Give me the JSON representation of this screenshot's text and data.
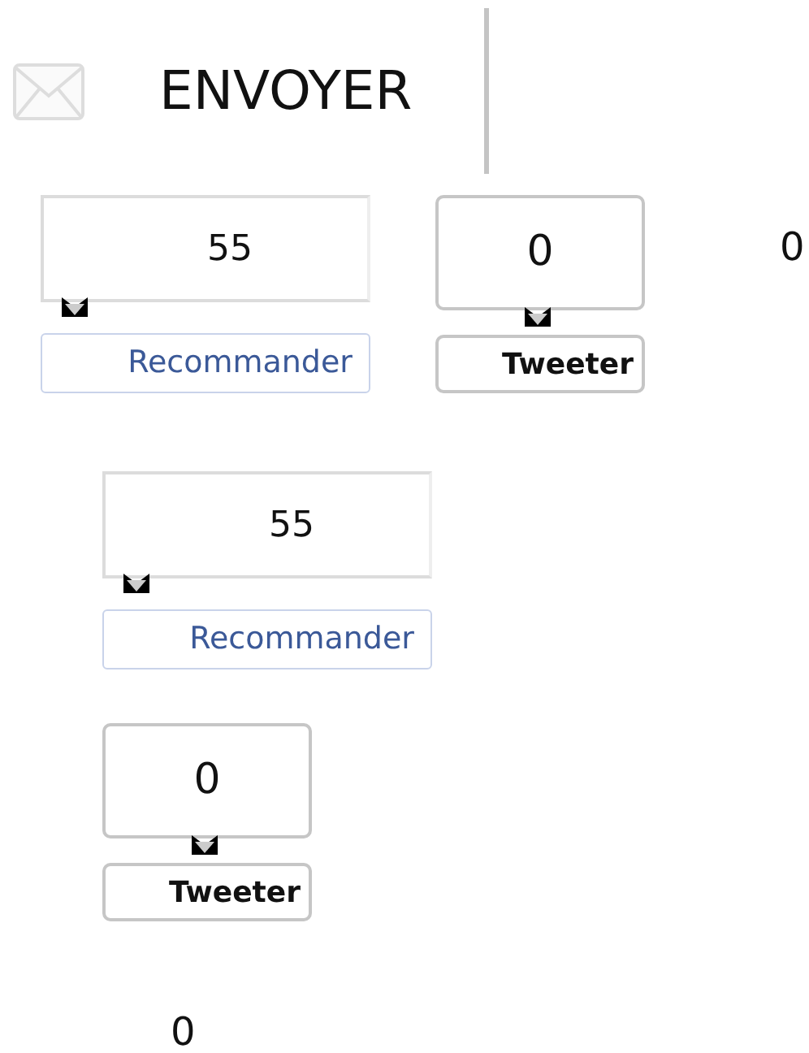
{
  "email": {
    "label": "ENVOYER"
  },
  "share_rows": [
    [
      {
        "kind": "facebook",
        "count": "55",
        "label": "Recommander"
      },
      {
        "kind": "twitter",
        "count": "0",
        "label": "Tweeter"
      },
      {
        "kind": "plain",
        "count": "0"
      }
    ],
    [
      {
        "kind": "facebook",
        "count": "55",
        "label": "Recommander"
      }
    ],
    [
      {
        "kind": "twitter",
        "count": "0",
        "label": "Tweeter"
      }
    ],
    [
      {
        "kind": "plain",
        "count": "0"
      }
    ]
  ]
}
